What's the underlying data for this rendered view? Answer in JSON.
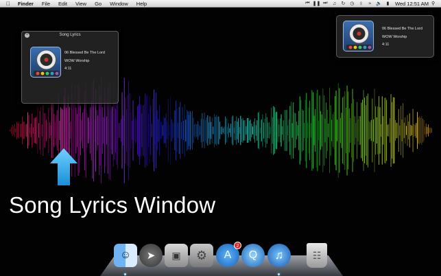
{
  "menubar": {
    "app_name": "Finder",
    "menus": [
      "File",
      "Edit",
      "View",
      "Go",
      "Window",
      "Help"
    ],
    "clock": "Wed 12:51 AM"
  },
  "lyrics_window": {
    "title": "Song Lyrics",
    "track": "06 Blessed Be The Lord",
    "artist": "WOW Worship",
    "duration": "4:11"
  },
  "mini_player": {
    "track": "06 Blessed Be The Lord",
    "artist": "WOW Worship",
    "duration": "4:11"
  },
  "caption": "Song Lyrics Window",
  "dock": {
    "app_store_badge": "2"
  },
  "colors": {
    "menubar": "#e6e6e6",
    "hud": "#262626",
    "arrow": "#2ea8e8"
  }
}
